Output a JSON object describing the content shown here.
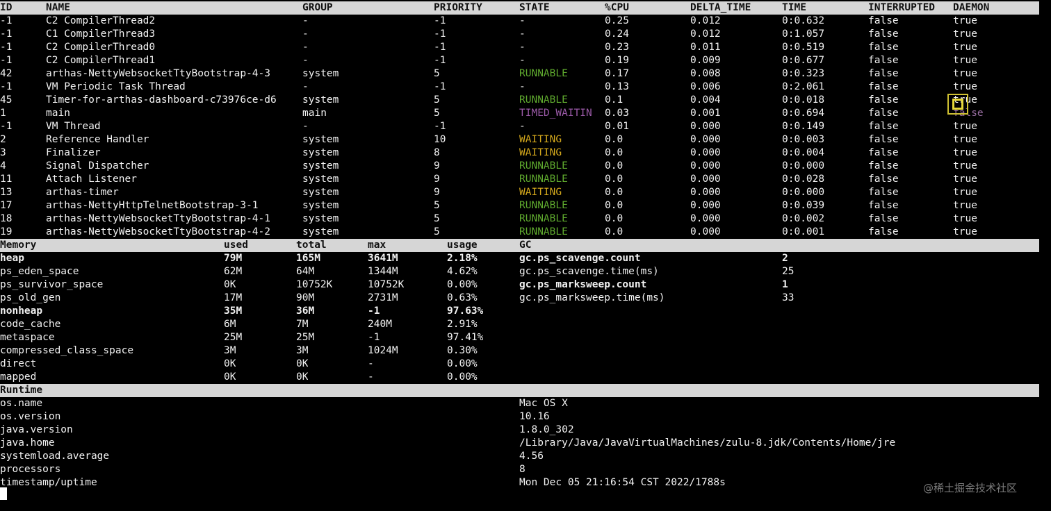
{
  "thread_table": {
    "headers": [
      "ID",
      "NAME",
      "GROUP",
      "PRIORITY",
      "STATE",
      "%CPU",
      "DELTA_TIME",
      "TIME",
      "INTERRUPTED",
      "DAEMON"
    ],
    "rows": [
      [
        "-1",
        "C2 CompilerThread2",
        "-",
        "-1",
        "-",
        "0.25",
        "0.012",
        "0:0.632",
        "false",
        "true"
      ],
      [
        "-1",
        "C1 CompilerThread3",
        "-",
        "-1",
        "-",
        "0.24",
        "0.012",
        "0:1.057",
        "false",
        "true"
      ],
      [
        "-1",
        "C2 CompilerThread0",
        "-",
        "-1",
        "-",
        "0.23",
        "0.011",
        "0:0.519",
        "false",
        "true"
      ],
      [
        "-1",
        "C2 CompilerThread1",
        "-",
        "-1",
        "-",
        "0.19",
        "0.009",
        "0:0.677",
        "false",
        "true"
      ],
      [
        "42",
        "arthas-NettyWebsocketTtyBootstrap-4-3",
        "system",
        "5",
        "RUNNABLE",
        "0.17",
        "0.008",
        "0:0.323",
        "false",
        "true"
      ],
      [
        "-1",
        "VM Periodic Task Thread",
        "-",
        "-1",
        "-",
        "0.13",
        "0.006",
        "0:2.061",
        "false",
        "true"
      ],
      [
        "45",
        "Timer-for-arthas-dashboard-c73976ce-d6",
        "system",
        "5",
        "RUNNABLE",
        "0.1",
        "0.004",
        "0:0.018",
        "false",
        "true"
      ],
      [
        "1",
        "main",
        "main",
        "5",
        "TIMED_WAITIN",
        "0.03",
        "0.001",
        "0:0.694",
        "false",
        "false"
      ],
      [
        "-1",
        "VM Thread",
        "-",
        "-1",
        "-",
        "0.01",
        "0.000",
        "0:0.149",
        "false",
        "true"
      ],
      [
        "2",
        "Reference Handler",
        "system",
        "10",
        "WAITING",
        "0.0",
        "0.000",
        "0:0.003",
        "false",
        "true"
      ],
      [
        "3",
        "Finalizer",
        "system",
        "8",
        "WAITING",
        "0.0",
        "0.000",
        "0:0.004",
        "false",
        "true"
      ],
      [
        "4",
        "Signal Dispatcher",
        "system",
        "9",
        "RUNNABLE",
        "0.0",
        "0.000",
        "0:0.000",
        "false",
        "true"
      ],
      [
        "11",
        "Attach Listener",
        "system",
        "9",
        "RUNNABLE",
        "0.0",
        "0.000",
        "0:0.028",
        "false",
        "true"
      ],
      [
        "13",
        "arthas-timer",
        "system",
        "9",
        "WAITING",
        "0.0",
        "0.000",
        "0:0.000",
        "false",
        "true"
      ],
      [
        "17",
        "arthas-NettyHttpTelnetBootstrap-3-1",
        "system",
        "5",
        "RUNNABLE",
        "0.0",
        "0.000",
        "0:0.039",
        "false",
        "true"
      ],
      [
        "18",
        "arthas-NettyWebsocketTtyBootstrap-4-1",
        "system",
        "5",
        "RUNNABLE",
        "0.0",
        "0.000",
        "0:0.002",
        "false",
        "true"
      ],
      [
        "19",
        "arthas-NettyWebsocketTtyBootstrap-4-2",
        "system",
        "5",
        "RUNNABLE",
        "0.0",
        "0.000",
        "0:0.001",
        "false",
        "true"
      ]
    ]
  },
  "memory_table": {
    "headers": [
      "Memory",
      "used",
      "total",
      "max",
      "usage",
      "GC"
    ],
    "rows": [
      {
        "name": "heap",
        "used": "79M",
        "total": "165M",
        "max": "3641M",
        "usage": "2.18%",
        "bold": true
      },
      {
        "name": "ps_eden_space",
        "used": "62M",
        "total": "64M",
        "max": "1344M",
        "usage": "4.62%",
        "bold": false
      },
      {
        "name": "ps_survivor_space",
        "used": "0K",
        "total": "10752K",
        "max": "10752K",
        "usage": "0.00%",
        "bold": false
      },
      {
        "name": "ps_old_gen",
        "used": "17M",
        "total": "90M",
        "max": "2731M",
        "usage": "0.63%",
        "bold": false
      },
      {
        "name": "nonheap",
        "used": "35M",
        "total": "36M",
        "max": "-1",
        "usage": "97.63%",
        "bold": true
      },
      {
        "name": "code_cache",
        "used": "6M",
        "total": "7M",
        "max": "240M",
        "usage": "2.91%",
        "bold": false
      },
      {
        "name": "metaspace",
        "used": "25M",
        "total": "25M",
        "max": "-1",
        "usage": "97.41%",
        "bold": false
      },
      {
        "name": "compressed_class_space",
        "used": "3M",
        "total": "3M",
        "max": "1024M",
        "usage": "0.30%",
        "bold": false
      },
      {
        "name": "direct",
        "used": "0K",
        "total": "0K",
        "max": "-",
        "usage": "0.00%",
        "bold": false
      },
      {
        "name": "mapped",
        "used": "0K",
        "total": "0K",
        "max": "-",
        "usage": "0.00%",
        "bold": false
      }
    ],
    "gc": [
      {
        "name": "gc.ps_scavenge.count",
        "value": "2",
        "bold": true
      },
      {
        "name": "gc.ps_scavenge.time(ms)",
        "value": "25",
        "bold": false
      },
      {
        "name": "gc.ps_marksweep.count",
        "value": "1",
        "bold": true
      },
      {
        "name": "gc.ps_marksweep.time(ms)",
        "value": "33",
        "bold": false
      }
    ]
  },
  "runtime_table": {
    "header": "Runtime",
    "rows": [
      {
        "key": "os.name",
        "value": "Mac OS X"
      },
      {
        "key": "os.version",
        "value": "10.16"
      },
      {
        "key": "java.version",
        "value": "1.8.0_302"
      },
      {
        "key": "java.home",
        "value": "/Library/Java/JavaVirtualMachines/zulu-8.jdk/Contents/Home/jre"
      },
      {
        "key": "systemload.average",
        "value": "4.56"
      },
      {
        "key": "processors",
        "value": "8"
      },
      {
        "key": "timestamp/uptime",
        "value": "Mon Dec 05 21:16:54 CST 2022/1788s"
      }
    ]
  },
  "watermark": "@稀土掘金技术社区",
  "colors": {
    "header_bg": "#d6d6d6",
    "runnable": "#5faa2e",
    "waiting": "#d4a81c",
    "timed_waiting": "#9b5aa8",
    "focus_icon": "#cfc132"
  },
  "icons": {
    "focus": "focus-frame-icon"
  }
}
